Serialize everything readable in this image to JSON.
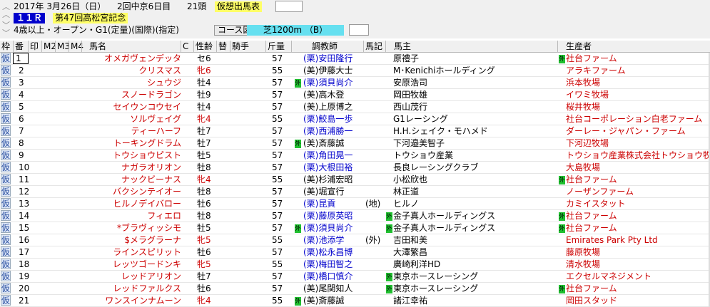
{
  "header": {
    "date": "2017年 3月26日（日）",
    "meeting": "2回中京6日目",
    "runners": "21頭",
    "prediction_button": "仮想出馬表",
    "race_no": "１１Ｒ",
    "race_name": "第47回高松宮記念",
    "conditions": "4歳以上・オープン・G1(定量)(国際)(指定)",
    "course_button": "コース図",
    "surface": "芝1200m （B）",
    "nav_up_icon": "double-chevron-up-icon",
    "nav_down_icon": "double-chevron-down-icon"
  },
  "columns": {
    "waku": "枠",
    "ban": "番",
    "in": "印",
    "m2": "M2",
    "m3": "M3",
    "m4": "M4",
    "name": "馬名",
    "c": "C",
    "sex_age": "性齢",
    "kae": "替",
    "jockey": "騎手",
    "weight": "斤量",
    "trainer": "調教師",
    "note": "馬記",
    "owner": "馬主",
    "breeder": "生産者"
  },
  "frame_label": "仮",
  "mark_glyph": "外",
  "colors": {
    "horse_name": "#cc0000",
    "ritto": "#0000cc",
    "miho": "#000000",
    "female": "#cc0000",
    "breeder": "#cc0000",
    "mark_green": "#20c030"
  },
  "horses": [
    {
      "no": "1",
      "name": "オメガヴェンデッタ",
      "sex": "セ6",
      "weight": "57",
      "trainer": "(栗)安田隆行",
      "tc": "blue",
      "tmark": false,
      "note": "",
      "owner": "原禮子",
      "omark": false,
      "breeder": "社台ファーム",
      "bmark": true,
      "female": false
    },
    {
      "no": "2",
      "name": "クリスマス",
      "sex": "牝6",
      "weight": "55",
      "trainer": "(美)伊藤大士",
      "tc": "black",
      "tmark": false,
      "note": "",
      "owner": "M･Kenichiホールディング",
      "omark": false,
      "breeder": "アラキファーム",
      "bmark": false,
      "female": true
    },
    {
      "no": "3",
      "name": "シュウジ",
      "sex": "牡4",
      "weight": "57",
      "trainer": "(栗)須貝尚介",
      "tc": "blue",
      "tmark": true,
      "note": "",
      "owner": "安原浩司",
      "omark": false,
      "breeder": "浜本牧場",
      "bmark": false,
      "female": false
    },
    {
      "no": "4",
      "name": "スノードラゴン",
      "sex": "牡9",
      "weight": "57",
      "trainer": "(美)高木登",
      "tc": "black",
      "tmark": false,
      "note": "",
      "owner": "岡田牧雄",
      "omark": false,
      "breeder": "イワミ牧場",
      "bmark": false,
      "female": false
    },
    {
      "no": "5",
      "name": "セイウンコウセイ",
      "sex": "牡4",
      "weight": "57",
      "trainer": "(美)上原博之",
      "tc": "black",
      "tmark": false,
      "note": "",
      "owner": "西山茂行",
      "omark": false,
      "breeder": "桜井牧場",
      "bmark": false,
      "female": false
    },
    {
      "no": "6",
      "name": "ソルヴェイグ",
      "sex": "牝4",
      "weight": "55",
      "trainer": "(栗)鮫島一歩",
      "tc": "blue",
      "tmark": false,
      "note": "",
      "owner": "G1レーシング",
      "omark": false,
      "breeder": "社台コーポレーション白老ファーム",
      "bmark": false,
      "female": true
    },
    {
      "no": "7",
      "name": "ティーハーフ",
      "sex": "牡7",
      "weight": "57",
      "trainer": "(栗)西浦勝一",
      "tc": "blue",
      "tmark": false,
      "note": "",
      "owner": "H.H.シェイク・モハメド",
      "omark": false,
      "breeder": "ダーレー・ジャパン・ファーム",
      "bmark": false,
      "female": false
    },
    {
      "no": "8",
      "name": "トーキングドラム",
      "sex": "牡7",
      "weight": "57",
      "trainer": "(美)斎藤誠",
      "tc": "black",
      "tmark": true,
      "note": "",
      "owner": "下河邉美智子",
      "omark": false,
      "breeder": "下河辺牧場",
      "bmark": false,
      "female": false
    },
    {
      "no": "9",
      "name": "トウショウピスト",
      "sex": "牡5",
      "weight": "57",
      "trainer": "(栗)角田晃一",
      "tc": "blue",
      "tmark": false,
      "note": "",
      "owner": "トウショウ産業",
      "omark": false,
      "breeder": "トウショウ産業株式会社トウショウ牧場",
      "bmark": false,
      "female": false
    },
    {
      "no": "10",
      "name": "ナガラオリオン",
      "sex": "牡8",
      "weight": "57",
      "trainer": "(栗)大根田裕",
      "tc": "blue",
      "tmark": false,
      "note": "",
      "owner": "長良レーシングクラブ",
      "omark": false,
      "breeder": "大島牧場",
      "bmark": false,
      "female": false
    },
    {
      "no": "11",
      "name": "ナックビーナス",
      "sex": "牝4",
      "weight": "55",
      "trainer": "(美)杉浦宏昭",
      "tc": "black",
      "tmark": false,
      "note": "",
      "owner": "小松欣也",
      "omark": false,
      "breeder": "社台ファーム",
      "bmark": true,
      "female": true
    },
    {
      "no": "12",
      "name": "バクシンテイオー",
      "sex": "牡8",
      "weight": "57",
      "trainer": "(美)堀宣行",
      "tc": "black",
      "tmark": false,
      "note": "",
      "owner": "林正道",
      "omark": false,
      "breeder": "ノーザンファーム",
      "bmark": false,
      "female": false
    },
    {
      "no": "13",
      "name": "ヒルノデイバロー",
      "sex": "牡6",
      "weight": "57",
      "trainer": "(栗)昆貢",
      "tc": "blue",
      "tmark": false,
      "note": "(地)",
      "owner": "ヒルノ",
      "omark": false,
      "breeder": "カミイスタット",
      "bmark": false,
      "female": false
    },
    {
      "no": "14",
      "name": "フィエロ",
      "sex": "牡8",
      "weight": "57",
      "trainer": "(栗)藤原英昭",
      "tc": "blue",
      "tmark": false,
      "note": "",
      "owner": "金子真人ホールディングス",
      "omark": true,
      "breeder": "社台ファーム",
      "bmark": true,
      "female": false
    },
    {
      "no": "15",
      "name": "*ブラヴィッシモ",
      "sex": "牡5",
      "weight": "57",
      "trainer": "(栗)須貝尚介",
      "tc": "blue",
      "tmark": true,
      "note": "",
      "owner": "金子真人ホールディングス",
      "omark": true,
      "breeder": "社台ファーム",
      "bmark": true,
      "female": false
    },
    {
      "no": "16",
      "name": "$メラグラーナ",
      "sex": "牝5",
      "weight": "55",
      "trainer": "(栗)池添学",
      "tc": "blue",
      "tmark": false,
      "note": "(外)",
      "owner": "吉田和美",
      "omark": false,
      "breeder": "Emirates Park Pty Ltd",
      "bmark": false,
      "female": true
    },
    {
      "no": "17",
      "name": "ラインスピリット",
      "sex": "牡6",
      "weight": "57",
      "trainer": "(栗)松永昌博",
      "tc": "blue",
      "tmark": false,
      "note": "",
      "owner": "大澤繁昌",
      "omark": false,
      "breeder": "藤原牧場",
      "bmark": false,
      "female": false
    },
    {
      "no": "18",
      "name": "レッツゴードンキ",
      "sex": "牝5",
      "weight": "55",
      "trainer": "(栗)梅田智之",
      "tc": "blue",
      "tmark": false,
      "note": "",
      "owner": "廣崎利洋HD",
      "omark": false,
      "breeder": "清水牧場",
      "bmark": false,
      "female": true
    },
    {
      "no": "19",
      "name": "レッドアリオン",
      "sex": "牡7",
      "weight": "57",
      "trainer": "(栗)橋口慎介",
      "tc": "blue",
      "tmark": false,
      "note": "",
      "owner": "東京ホースレーシング",
      "omark": true,
      "breeder": "エクセルマネジメント",
      "bmark": false,
      "female": false
    },
    {
      "no": "20",
      "name": "レッドファルクス",
      "sex": "牡6",
      "weight": "57",
      "trainer": "(美)尾関知人",
      "tc": "black",
      "tmark": false,
      "note": "",
      "owner": "東京ホースレーシング",
      "omark": true,
      "breeder": "社台ファーム",
      "bmark": true,
      "female": false
    },
    {
      "no": "21",
      "name": "ワンスインナムーン",
      "sex": "牝4",
      "weight": "55",
      "trainer": "(美)斎藤誠",
      "tc": "black",
      "tmark": true,
      "note": "",
      "owner": "諸江幸祐",
      "omark": false,
      "breeder": "岡田スタッド",
      "bmark": false,
      "female": true
    }
  ]
}
